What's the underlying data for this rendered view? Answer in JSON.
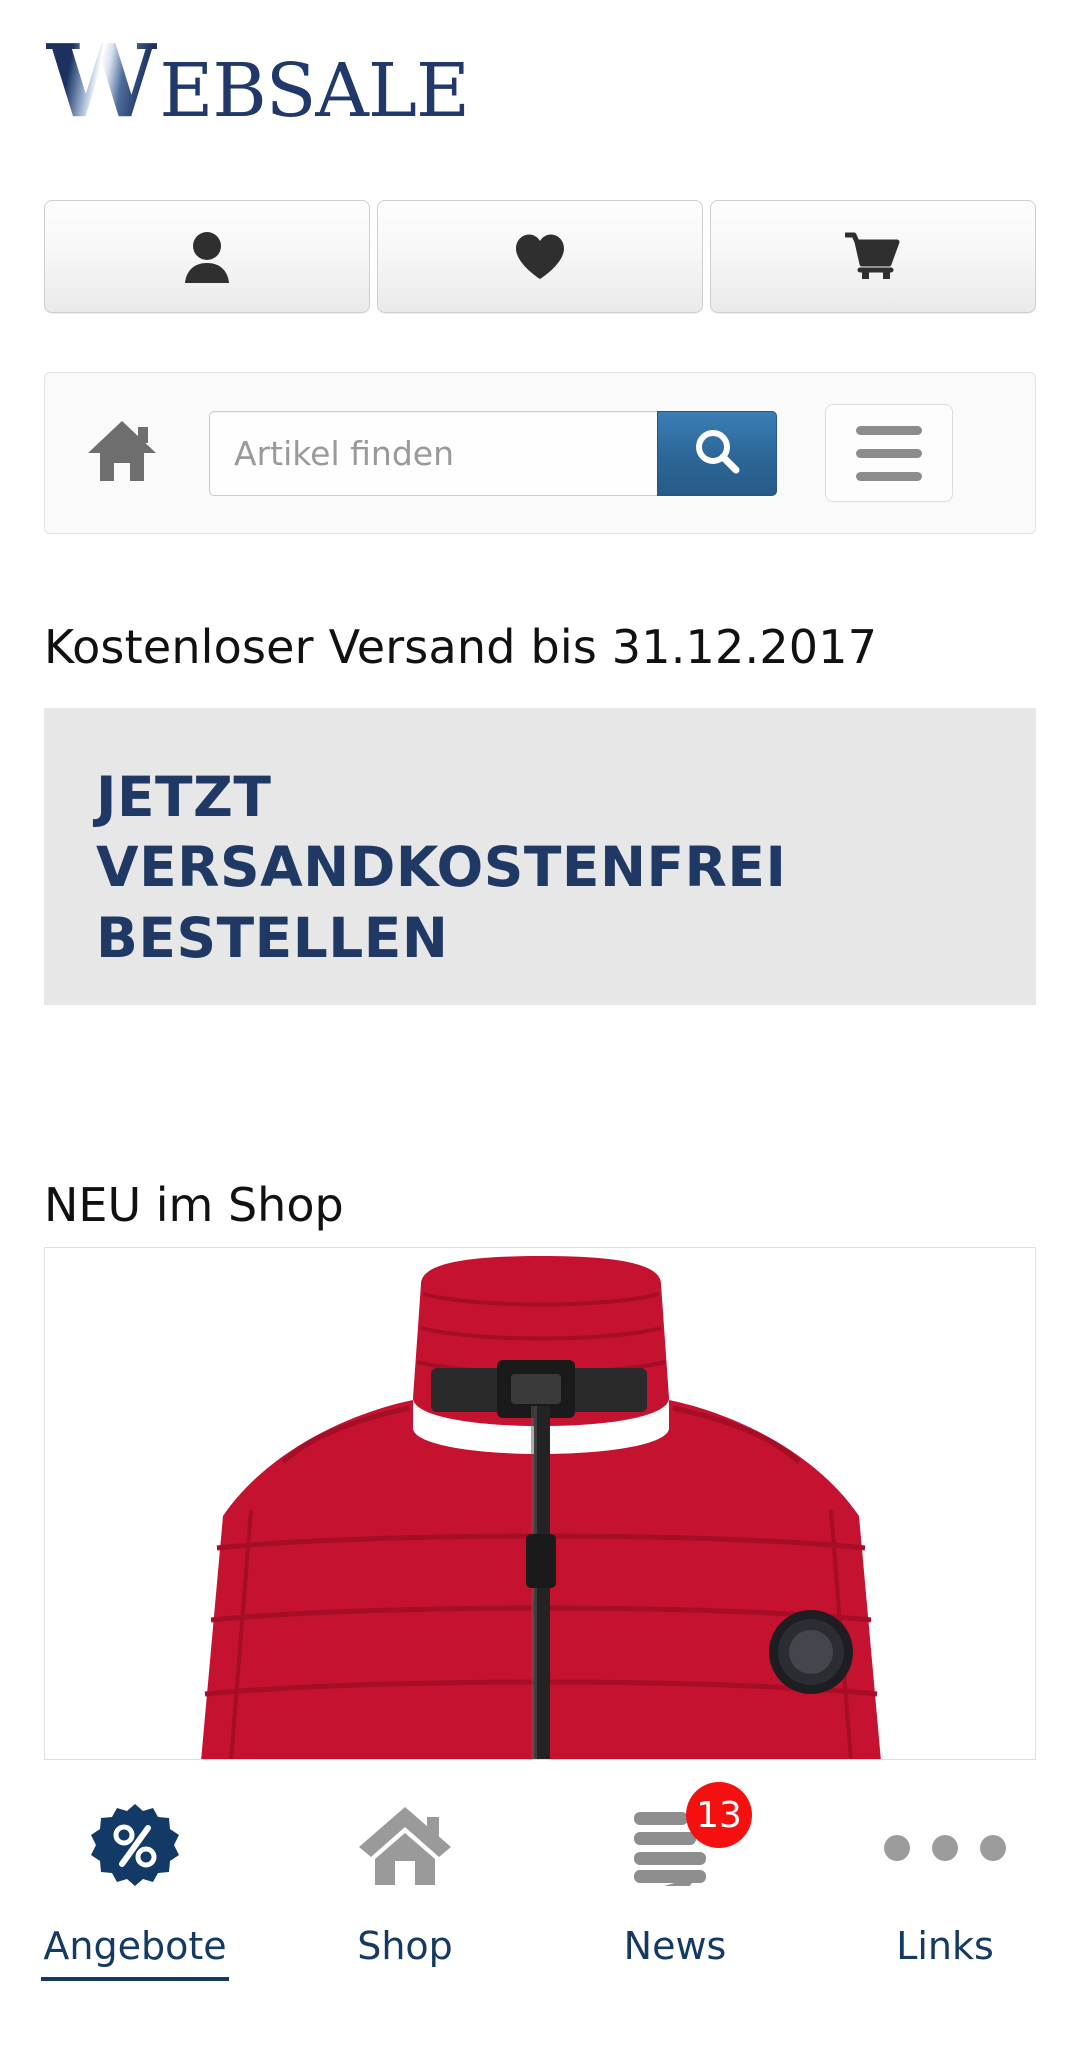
{
  "brand": {
    "logo_w": "W",
    "logo_rest": "EBSALE",
    "logo_full": "WEBSALE",
    "navy": "#1f3864"
  },
  "top_icons": [
    {
      "name": "account-button",
      "icon": "user-icon"
    },
    {
      "name": "wishlist-button",
      "icon": "heart-icon"
    },
    {
      "name": "cart-button",
      "icon": "shopping-cart-icon"
    }
  ],
  "search": {
    "home_icon": "home-icon",
    "placeholder": "Artikel finden",
    "value": "",
    "submit_icon": "search-icon",
    "menu_icon": "hamburger-menu-icon",
    "button_color": "#2c6697"
  },
  "promo": {
    "heading": "Kostenloser Versand bis 31.12.2017",
    "banner_text": "JETZT VERSANDKOSTENFREI BESTELLEN",
    "banner_bg": "#e7e7e7",
    "banner_text_color": "#1f3864"
  },
  "new_section": {
    "heading": "NEU im Shop",
    "product_alt": "red-puffer-jacket"
  },
  "bottom_nav": [
    {
      "label": "Angebote",
      "icon": "discount-percent-badge-icon",
      "active": true,
      "badge": null
    },
    {
      "label": "Shop",
      "icon": "home-icon",
      "active": false,
      "badge": null
    },
    {
      "label": "News",
      "icon": "news-messages-icon",
      "active": false,
      "badge": "13"
    },
    {
      "label": "Links",
      "icon": "more-dots-icon",
      "active": false,
      "badge": null
    }
  ],
  "colors": {
    "badge_red": "#f50f0f",
    "nav_label": "#143a62",
    "icon_gray": "#9c9c9c"
  }
}
